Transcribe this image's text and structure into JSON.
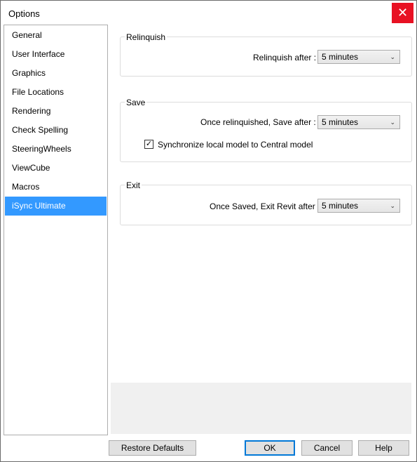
{
  "window": {
    "title": "Options",
    "close_glyph": "✕"
  },
  "nav": {
    "items": [
      {
        "label": "General"
      },
      {
        "label": "User Interface"
      },
      {
        "label": "Graphics"
      },
      {
        "label": "File Locations"
      },
      {
        "label": "Rendering"
      },
      {
        "label": "Check Spelling"
      },
      {
        "label": "SteeringWheels"
      },
      {
        "label": "ViewCube"
      },
      {
        "label": "Macros"
      },
      {
        "label": "iSync Ultimate"
      }
    ],
    "selected": "iSync Ultimate"
  },
  "relinquish": {
    "title": "Relinquish",
    "after_label": "Relinquish after :",
    "after_value": "5 minutes"
  },
  "save": {
    "title": "Save",
    "after_label": "Once relinquished,  Save after :",
    "after_value": "5 minutes",
    "sync_checked": true,
    "sync_label": "Synchronize  local model to Central model"
  },
  "exit": {
    "title": "Exit",
    "after_label": "Once Saved, Exit Revit after :",
    "after_value": "5 minutes"
  },
  "buttons": {
    "restore": "Restore Defaults",
    "ok": "OK",
    "cancel": "Cancel",
    "help": "Help"
  },
  "glyphs": {
    "chevron": "⌄",
    "check": "✓"
  },
  "colors": {
    "selection": "#3399ff",
    "close": "#e81123",
    "default_button_border": "#0078d7"
  }
}
